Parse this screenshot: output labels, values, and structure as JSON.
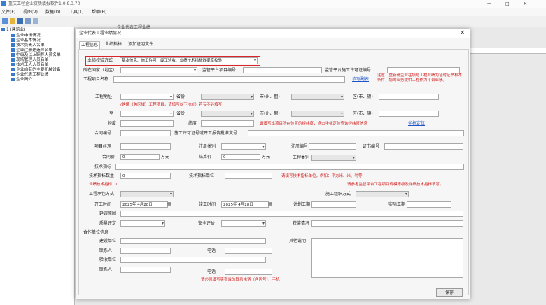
{
  "app": {
    "title": "重庆工程企业资质填报软件1.0.8.3.70",
    "menu": [
      "文件(F)",
      "视图(V)",
      "数据(D)",
      "工具(T)",
      "帮助(H)"
    ],
    "pane_title": "企业代表工程业绩"
  },
  "tree": {
    "root": "1 (建筑业)",
    "items": [
      "企业申请情况",
      "企业基本情况",
      "技术负责人名单",
      "企业注册建造师名单",
      "中级及以上职称人员名单",
      "现场管理人员名单",
      "技术工人人员名单",
      "企业自有的主要机械设备",
      "企业代表工程业绩",
      "企业简介"
    ]
  },
  "dialog": {
    "title": "企业代表工程业绩情况",
    "close": "×",
    "tabs": [
      "工程信息",
      "业绩指标",
      "添加证明文件"
    ],
    "check_method_label": "业绩校验方式",
    "check_method_value": "基本信息、施工许可、竣工验收、业绩技术指标数据库校验",
    "country_label": "所在国家（地区）",
    "platform_no_label": "监管平台项目编号",
    "platform_permit_label": "监管平台施工许可证编号",
    "project_name_label": "工程项目名称",
    "fill_info_link": "填写副表",
    "notice": "注意：重新请企业在填写工程业绩为证时证书和本条件，您的业务提供工程作为平台业绩。",
    "addr_label": "工程地址",
    "province_label": "省份",
    "city_label": "市(州、盟)",
    "district_label": "区(市、旗)",
    "to_label": "至",
    "cross_hint": "(跨境（跨区域）工程项目，请填写以下地址）若有不必填写",
    "lng_label": "经度",
    "lat_label": "纬度",
    "lnglat_hint": "请填写本项目所在位置的经纬度，点击坐标定位查询经纬度信息",
    "coord_link": "坐标定位",
    "contract_no_label": "合同编号",
    "permit_no_label": "施工许可证号或开工报告批准文号",
    "pm_label": "项目经理",
    "reg_type_label": "注册类别",
    "reg_no_label": "注册编号",
    "cert_no_label": "证书编号",
    "contract_amount_label": "合同价",
    "contract_amount": "0",
    "wan_yuan": "万元",
    "settle_label": "结算价",
    "settle_amount": "0",
    "project_type_label": "工程类别",
    "tech_index_label": "技术指标",
    "tech_qty_label": "技术指标数量",
    "tech_qty": "0",
    "tech_unit_label": "技术指标单位",
    "tech_unit_hint": "请填写技术指标单位，例如：平方米、米、吨等",
    "perf_note_label": "业绩技术指标：0",
    "ref_hint": "请参考监管平台工程项目规模等级及详细技术指标填写。",
    "contract_mode_label": "工程承包方式",
    "org_mode_label": "施工组织方式",
    "start_label": "开工时间",
    "start_value": "2025年 4月28日",
    "finish_label": "竣工时间",
    "finish_value": "2025年 4月28日",
    "plan_period_label": "计划工期",
    "actual_period_label": "实际工期",
    "delay_label": "延误原因",
    "quality_label": "质量评定",
    "safety_label": "安全评价",
    "award_label": "获奖情况",
    "partner_label": "合作单位信息",
    "builder_unit_label": "建设单位",
    "contact_label": "联系人",
    "phone_label": "电话",
    "inspect_unit_label": "验收单位",
    "contact2_label": "联系人",
    "phone2_label": "电话",
    "other_label": "其他说明",
    "phone_hint": "请必须填写实有效的联系电话（含区号）、手机",
    "save_btn": "保存"
  },
  "colors": {
    "highlight": "#d8262b",
    "hint": "#d21b1b",
    "link": "#1f55c8"
  }
}
